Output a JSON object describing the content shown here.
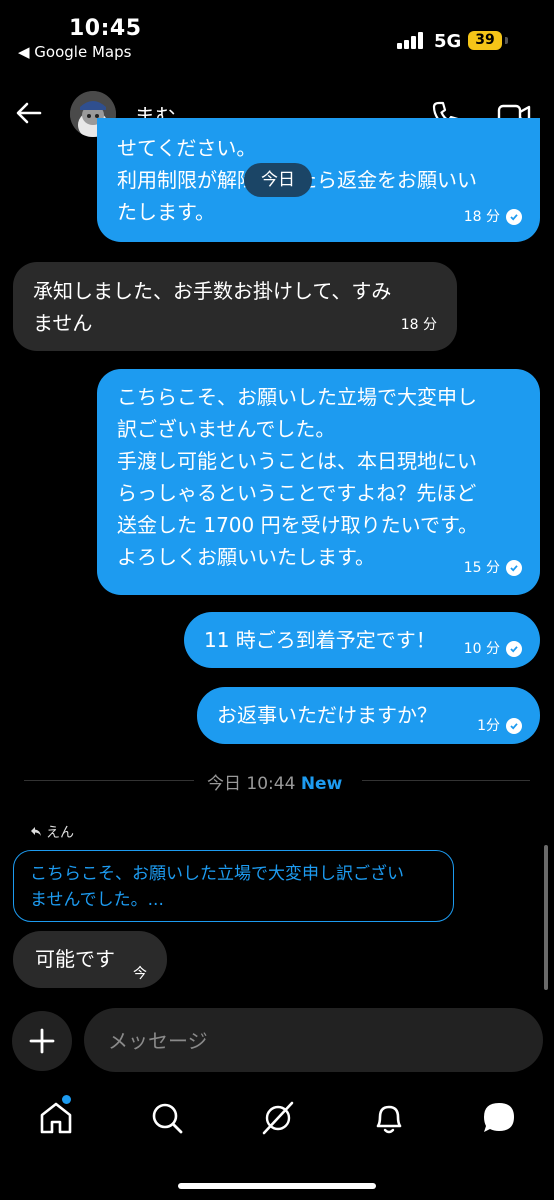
{
  "status_bar": {
    "time": "10:45",
    "back_app": "◀ Google Maps",
    "network": "5G",
    "battery": "39"
  },
  "header": {
    "contact_name": "まむ"
  },
  "date_pill": "今日",
  "messages": [
    {
      "text": "せてください。\n利用制限が解除されたら返金をお願いい\nたします。",
      "time": "18 分",
      "read": true
    },
    {
      "text": "承知しました、お手数お掛けして、すみ\nません",
      "time": "18 分"
    },
    {
      "text": "こちらこそ、お願いした立場で大変申し\n訳ございませんでした。\n手渡し可能ということは、本日現地にい\nらっしゃるということですよね？先ほど\n送金した 1700 円を受け取りたいです。\nよろしくお願いいたします。",
      "time": "15 分",
      "read": true
    },
    {
      "text": "11 時ごろ到着予定です！",
      "time": "10 分",
      "read": true
    },
    {
      "text": "お返事いただけますか？",
      "time": "1分",
      "read": true
    }
  ],
  "divider": {
    "text": "今日 10:44",
    "new_label": "New"
  },
  "reply": {
    "label": "えん",
    "quote": "こちらこそ、お願いした立場で大変申し訳ござい\nませんでした。..."
  },
  "last_message": {
    "text": "可能です",
    "time": "今"
  },
  "composer": {
    "placeholder": "メッセージ"
  },
  "colors": {
    "accent": "#1d9bf0",
    "received_bubble": "#2a2a2a",
    "background": "#000000"
  }
}
